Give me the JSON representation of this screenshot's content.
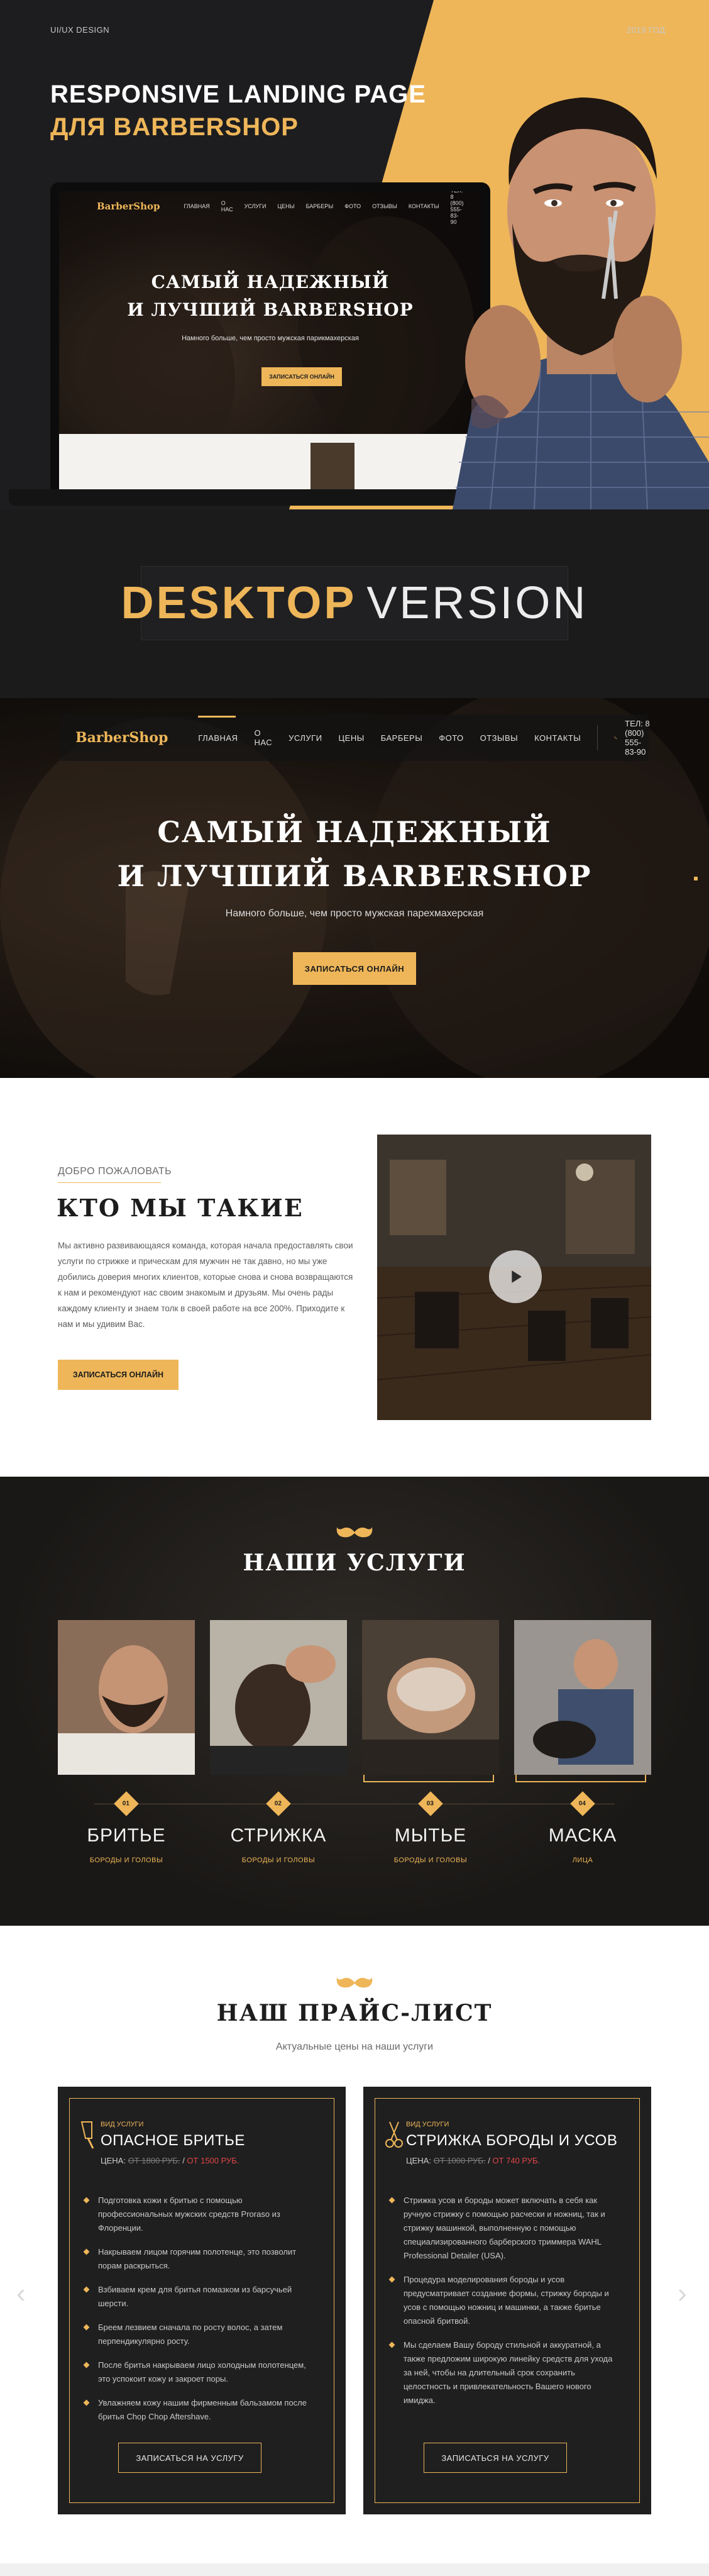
{
  "top": {
    "left_tag": "UI/UX DESIGN",
    "right_tag": "2019 ГОД"
  },
  "hero": {
    "title_line1": "RESPONSIVE LANDING PAGE",
    "title_line2": "ДЛЯ BARBERSHOP"
  },
  "mockup": {
    "logo": "BarberShop",
    "nav": [
      "ГЛАВНАЯ",
      "О НАС",
      "УСЛУГИ",
      "ЦЕНЫ",
      "БАРБЕРЫ",
      "ФОТО",
      "ОТЗЫВЫ",
      "КОНТАКТЫ"
    ],
    "phone": "ТЕЛ: 8 (800) 555-83-90",
    "headline1": "САМЫЙ НАДЕЖНЫЙ",
    "headline2": "И ЛУЧШИЙ BARBERSHOP",
    "subtitle": "Намного больше, чем просто мужская парикмахерская",
    "cta": "ЗАПИСАТЬСЯ ОНЛАЙН"
  },
  "desktop_version": {
    "bold": "DESKTOP",
    "light": "VERSION"
  },
  "desktop_hero": {
    "logo": "BarberShop",
    "nav": [
      "ГЛАВНАЯ",
      "О НАС",
      "УСЛУГИ",
      "ЦЕНЫ",
      "БАРБЕРЫ",
      "ФОТО",
      "ОТЗЫВЫ",
      "КОНТАКТЫ"
    ],
    "phone": "ТЕЛ: 8 (800) 555-83-90",
    "headline1": "САМЫЙ НАДЕЖНЫЙ",
    "headline2": "И ЛУЧШИЙ BARBERSHOP",
    "subtitle": "Намного больше, чем просто мужская парехмахерская",
    "cta": "ЗАПИСАТЬСЯ ОНЛАЙН"
  },
  "about": {
    "kicker": "ДОБРО ПОЖАЛОВАТЬ",
    "title": "КТО МЫ ТАКИЕ",
    "text": "Мы активно развивающаяся команда, которая начала предоставлять свои услуги по стрижке и прическам для мужчин не так давно, но мы уже добились доверия многих клиентов, которые снова и снова возвращаются к нам и рекомендуют нас своим знакомым и друзьям. Мы очень рады каждому клиенту и знаем толк в своей работе на все 200%. Приходите к нам и мы удивим Вас.",
    "cta": "ЗАПИСАТЬСЯ ОНЛАЙН"
  },
  "services": {
    "title": "НАШИ УСЛУГИ",
    "items": [
      {
        "num": "01",
        "name": "БРИТЬЕ",
        "sub": "БОРОДЫ И ГОЛОВЫ"
      },
      {
        "num": "02",
        "name": "СТРИЖКА",
        "sub": "БОРОДЫ И ГОЛОВЫ"
      },
      {
        "num": "03",
        "name": "МЫТЬЕ",
        "sub": "БОРОДЫ И ГОЛОВЫ"
      },
      {
        "num": "04",
        "name": "МАСКА",
        "sub": "ЛИЦА"
      }
    ]
  },
  "price": {
    "title": "НАШ ПРАЙС-ЛИСТ",
    "subtitle": "Актуальные цены на наши услуги",
    "cards": [
      {
        "kicker": "ВИД УСЛУГИ",
        "title": "ОПАСНОЕ БРИТЬЕ",
        "price_label": "ЦЕНА:",
        "old_price": "ОТ 1800 РУБ.",
        "new_price": "ОТ 1500 РУБ.",
        "items": [
          "Подготовка кожи к бритью с помощью профессиональных мужских средств Proraso из Флоренции.",
          "Накрываем лицом горячим полотенце, это позволит порам раскрыться.",
          "Взбиваем крем для бритья помазком из барсучьей шерсти.",
          "Бреем лезвием сначала по росту волос, а затем перпендикулярно росту.",
          "После бритья накрываем лицо холодным полотенцем, это успокоит кожу и закроет поры.",
          "Увлажняем кожу нашим фирменным бальзамом после бритья Chop Chop Aftershave."
        ],
        "cta": "ЗАПИСАТЬСЯ НА УСЛУГУ"
      },
      {
        "kicker": "ВИД УСЛУГИ",
        "title": "СТРИЖКА БОРОДЫ И УСОВ",
        "price_label": "ЦЕНА:",
        "old_price": "ОТ 1000 РУБ.",
        "new_price": "ОТ 740 РУБ.",
        "items": [
          "Стрижка усов и бороды может включать в себя как ручную стрижку с помощью расчески и ножниц, так и стрижку машинкой, выполненную с помощью специализированного барберского триммера WAHL Professional Detailer (USA).",
          "Процедура моделирования бороды и усов предусматривает создание формы, стрижку бороды и усов с помощью ножниц и машинки, а также бритье опасной бритвой.",
          "Мы сделаем Вашу бороду стильной и аккуратной, а также предложим широкую линейку средств для ухода за ней, чтобы на длительный срок сохранить целостность и привлекательность Вашего нового имиджа."
        ],
        "cta": "ЗАПИСАТЬСЯ НА УСЛУГУ"
      }
    ]
  },
  "colors": {
    "gold": "#eeb659",
    "dark": "#1d1d1f",
    "red": "#e24646"
  },
  "icons": [
    "phone-icon",
    "play-icon",
    "mustache-icon",
    "razor-icon",
    "scissors-icon",
    "arrow-left-icon",
    "arrow-right-icon"
  ]
}
